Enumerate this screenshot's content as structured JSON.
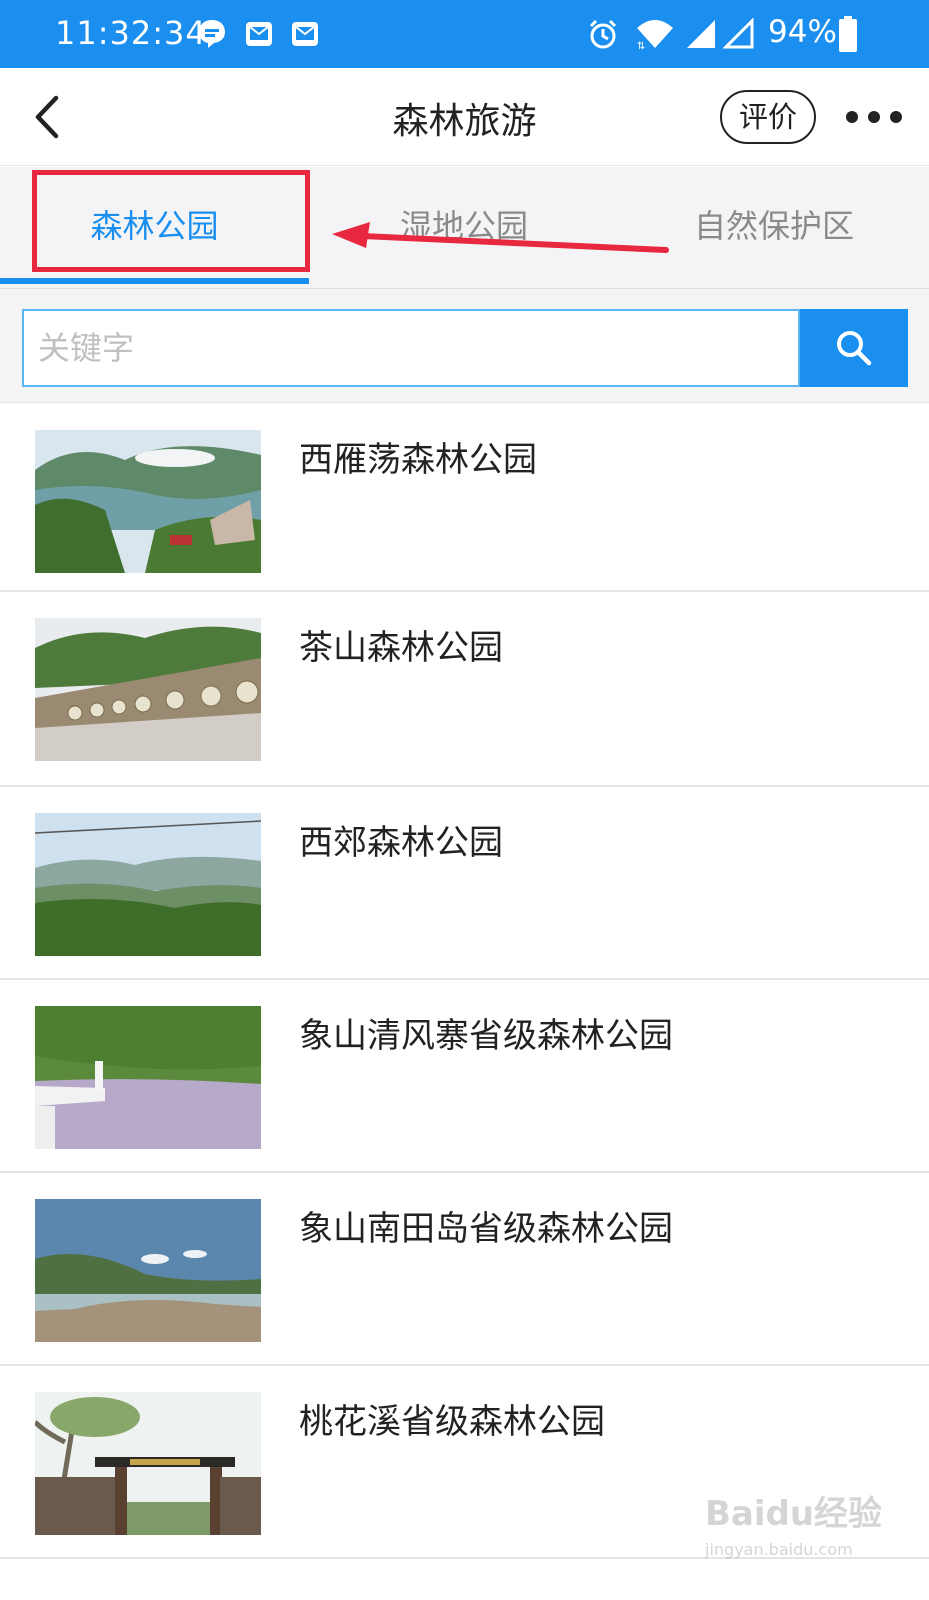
{
  "status_bar": {
    "time": "11:32:34",
    "battery_percent": "94%",
    "icons": [
      "chat-notification-icon",
      "mail-icon",
      "mail-icon",
      "alarm-icon",
      "wifi-icon",
      "signal-icon",
      "signal-empty-icon",
      "battery-icon"
    ]
  },
  "header": {
    "title": "森林旅游",
    "rate_label": "评价"
  },
  "tabs": [
    {
      "label": "森林公园",
      "active": true
    },
    {
      "label": "湿地公园",
      "active": false
    },
    {
      "label": "自然保护区",
      "active": false
    }
  ],
  "search": {
    "placeholder": "关键字",
    "value": ""
  },
  "list": [
    {
      "title": "西雁荡森林公园"
    },
    {
      "title": "茶山森林公园"
    },
    {
      "title": "西郊森林公园"
    },
    {
      "title": "象山清风寨省级森林公园"
    },
    {
      "title": "象山南田岛省级森林公园"
    },
    {
      "title": "桃花溪省级森林公园"
    }
  ],
  "colors": {
    "accent": "#1a8ff0",
    "annotation_red": "#e8283f"
  },
  "watermark": {
    "logo_text": "Baidu经验",
    "url_text": "jingyan.baidu.com"
  }
}
